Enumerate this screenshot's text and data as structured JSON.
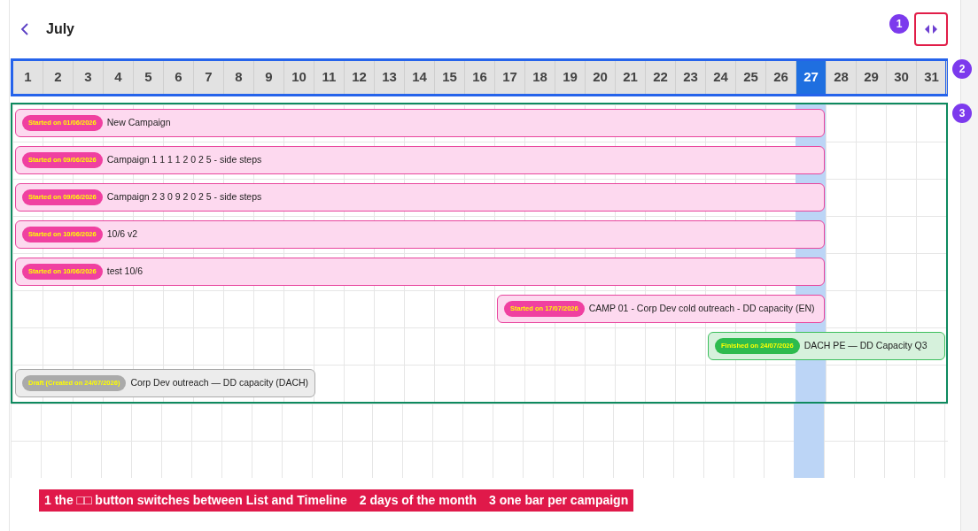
{
  "header": {
    "month": "July"
  },
  "days": [
    {
      "label": "1",
      "selected": false
    },
    {
      "label": "2",
      "selected": false
    },
    {
      "label": "3",
      "selected": false
    },
    {
      "label": "4",
      "selected": false
    },
    {
      "label": "5",
      "selected": false
    },
    {
      "label": "6",
      "selected": false
    },
    {
      "label": "7",
      "selected": false
    },
    {
      "label": "8",
      "selected": false
    },
    {
      "label": "9",
      "selected": false
    },
    {
      "label": "10",
      "selected": false
    },
    {
      "label": "11",
      "selected": false
    },
    {
      "label": "12",
      "selected": false
    },
    {
      "label": "13",
      "selected": false
    },
    {
      "label": "14",
      "selected": false
    },
    {
      "label": "15",
      "selected": false
    },
    {
      "label": "16",
      "selected": false
    },
    {
      "label": "17",
      "selected": false
    },
    {
      "label": "18",
      "selected": false
    },
    {
      "label": "19",
      "selected": false
    },
    {
      "label": "20",
      "selected": false
    },
    {
      "label": "21",
      "selected": false
    },
    {
      "label": "22",
      "selected": false
    },
    {
      "label": "23",
      "selected": false
    },
    {
      "label": "24",
      "selected": false
    },
    {
      "label": "25",
      "selected": false
    },
    {
      "label": "26",
      "selected": false
    },
    {
      "label": "27",
      "selected": true
    },
    {
      "label": "28",
      "selected": false
    },
    {
      "label": "29",
      "selected": false
    },
    {
      "label": "30",
      "selected": false
    },
    {
      "label": "31",
      "selected": false
    }
  ],
  "campaigns": [
    {
      "kind": "started",
      "badge": "Started on 01/06/2026",
      "name": "New Campaign"
    },
    {
      "kind": "started",
      "badge": "Started on 09/06/2026",
      "name": "Campaign 1 1 1 1 2 0 2 5 - side steps"
    },
    {
      "kind": "started",
      "badge": "Started on 09/06/2026",
      "name": "Campaign 2 3 0 9 2 0 2 5 - side steps"
    },
    {
      "kind": "started",
      "badge": "Started on 10/06/2026",
      "name": "10/6 v2"
    },
    {
      "kind": "started",
      "badge": "Started on 10/06/2026",
      "name": "test 10/6"
    },
    {
      "kind": "started",
      "badge": "Started on 17/07/2026",
      "name": "CAMP 01 - Corp Dev cold outreach - DD capacity (EN)"
    },
    {
      "kind": "finished",
      "badge": "Finished on 24/07/2026",
      "name": "DACH PE — DD Capacity Q3"
    },
    {
      "kind": "draft",
      "badge": "Draft (Created on 24/07/2026)",
      "name": "Corp Dev outreach — DD capacity (DACH)"
    }
  ],
  "annotations": [
    "1",
    "2",
    "3"
  ],
  "caption": [
    "1 the □□ button switches between List and Timeline",
    "2 days of the month",
    "3 one bar per campaign"
  ]
}
